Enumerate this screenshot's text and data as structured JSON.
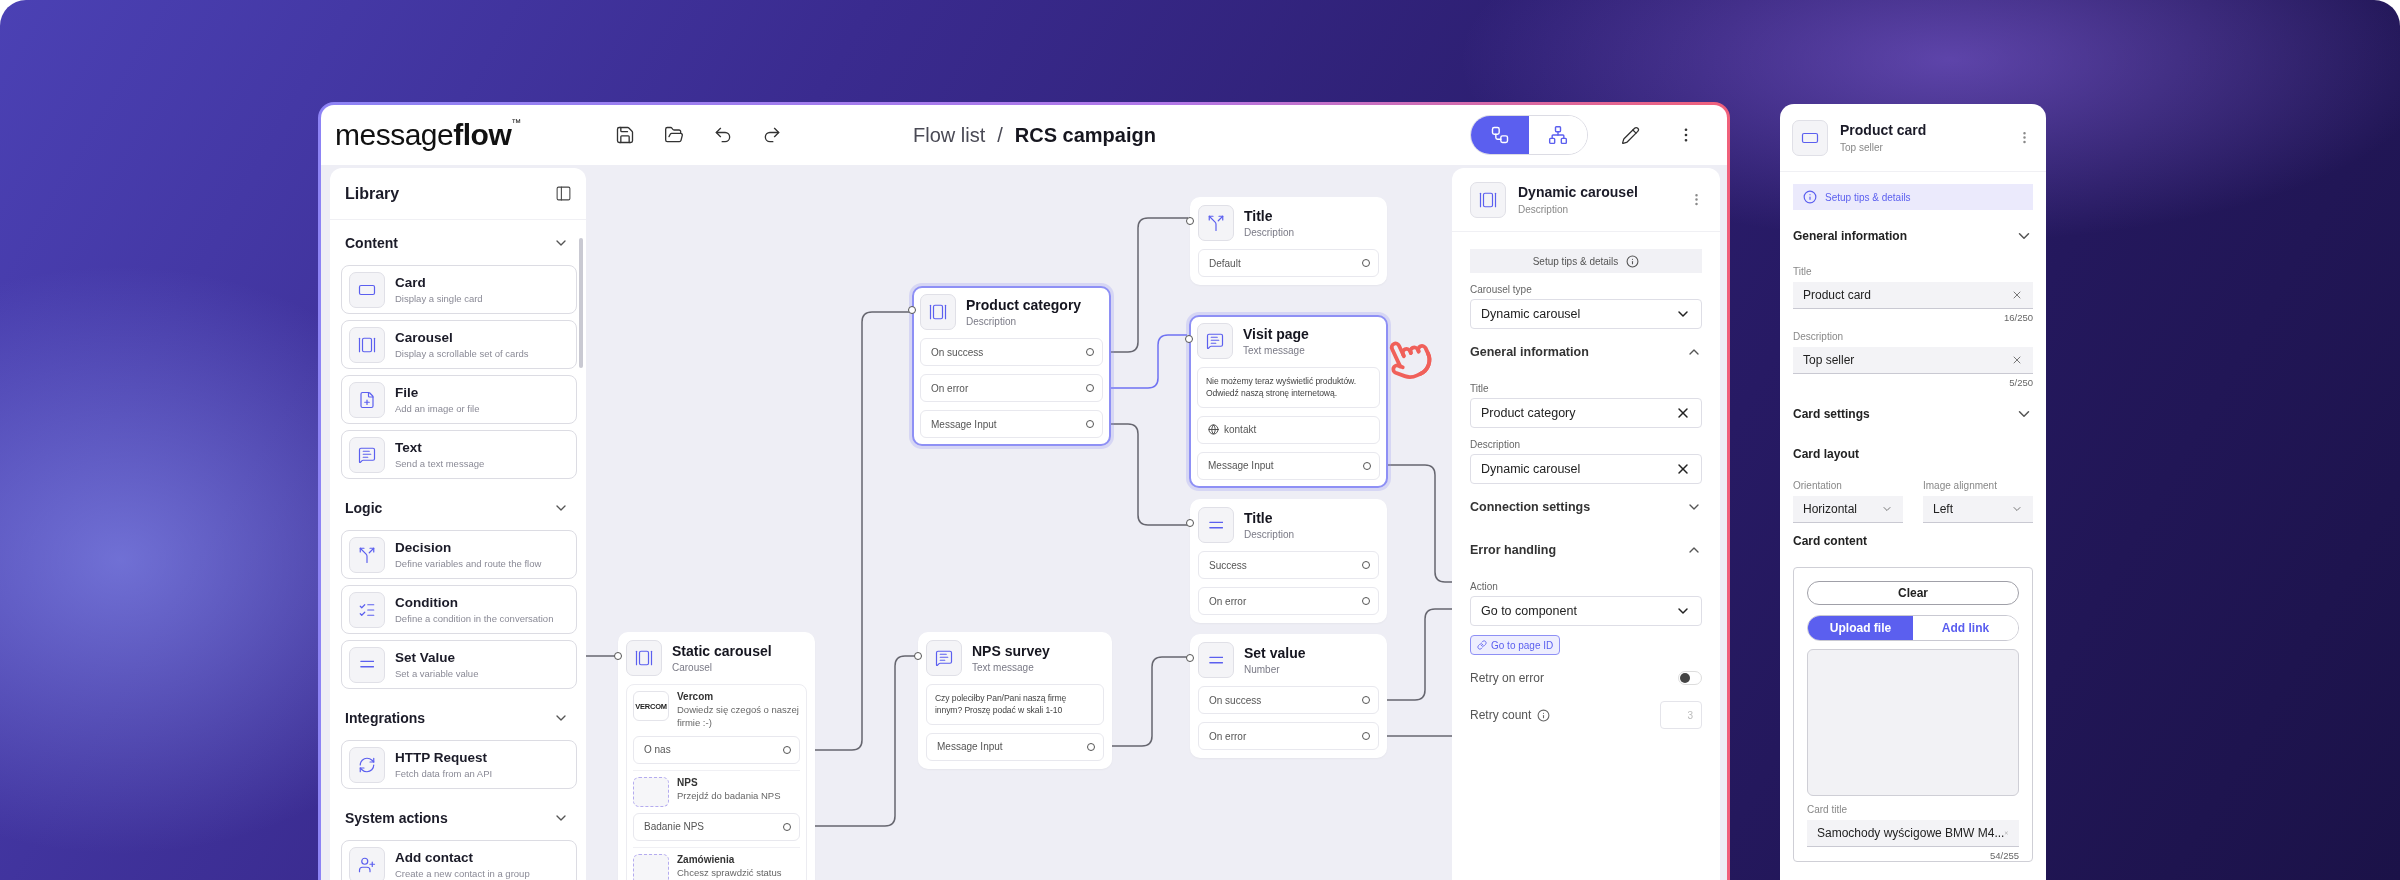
{
  "header": {
    "logo": "message**flow**$^{™}$",
    "breadcrumb": [
      "Flow list",
      "RCS campaign"
    ],
    "separator": "/",
    "view_toggle": [
      {
        "kind": "flow",
        "selected": true
      },
      {
        "kind": "tree",
        "selected": false
      }
    ]
  },
  "library": {
    "title": "Library",
    "sections": [
      {
        "title": "Content",
        "items": [
          {
            "kind": "card",
            "title": "Card",
            "description": "Display a single card"
          },
          {
            "kind": "carousel",
            "title": "Carousel",
            "description": "Display a scrollable set of cards"
          },
          {
            "kind": "file",
            "title": "File",
            "description": "Add an image or file"
          },
          {
            "kind": "text",
            "title": "Text",
            "description": "Send a text message"
          }
        ]
      },
      {
        "title": "Logic",
        "items": [
          {
            "kind": "decision",
            "title": "Decision",
            "description": "Define variables and route the flow"
          },
          {
            "kind": "condition",
            "title": "Condition",
            "description": "Define a condition in the conversation"
          },
          {
            "kind": "set_value",
            "title": "Set Value",
            "description": "Set a variable value"
          }
        ]
      },
      {
        "title": "Integrations",
        "items": [
          {
            "kind": "http",
            "title": "HTTP Request",
            "description": "Fetch data from an API"
          }
        ]
      },
      {
        "title": "System actions",
        "items": [
          {
            "kind": "contact",
            "title": "Add contact",
            "description": "Create a new contact in a group"
          }
        ]
      }
    ]
  },
  "canvas": {
    "nodes": [
      {
        "kind": "decision",
        "title": "Title",
        "subtitle": "Description",
        "selected": false,
        "rows": [
          {
            "kind": "output",
            "label": "Default"
          }
        ]
      },
      {
        "kind": "carousel",
        "title": "Product category",
        "subtitle": "Description",
        "selected": true,
        "rows": [
          {
            "kind": "output",
            "label": "On success"
          },
          {
            "kind": "output",
            "label": "On error"
          },
          {
            "kind": "output",
            "label": "Message Input"
          }
        ]
      },
      {
        "kind": "text",
        "title": "Visit page",
        "subtitle": "Text message",
        "selected": true,
        "rows": [
          {
            "kind": "message",
            "text": "Nie możemy teraz wyświetlić produktów. Odwiedź naszą stronę internetową."
          },
          {
            "kind": "link",
            "label": "kontakt"
          },
          {
            "kind": "output",
            "label": "Message Input"
          }
        ]
      },
      {
        "kind": "set_value",
        "title": "Title",
        "subtitle": "Description",
        "selected": false,
        "rows": [
          {
            "kind": "output",
            "label": "Success"
          },
          {
            "kind": "output",
            "label": "On error"
          }
        ]
      },
      {
        "kind": "carousel",
        "title": "Static carousel",
        "subtitle": "Carousel",
        "selected": false,
        "cards": [
          {
            "kind": "logo",
            "logo": "VERCOM",
            "title": "Vercom",
            "text": "Dowiedz się czegoś o naszej firmie :-)",
            "button": "O nas"
          },
          {
            "kind": "placeholder",
            "title": "NPS",
            "text": "Przejdź do badania NPS",
            "button": "Badanie NPS"
          },
          {
            "kind": "placeholder",
            "title": "Zamówienia",
            "text": "Chcesz sprawdzić status"
          }
        ]
      },
      {
        "kind": "text",
        "title": "NPS survey",
        "subtitle": "Text message",
        "selected": false,
        "rows": [
          {
            "kind": "message",
            "text": "Czy poleciłby Pan/Pani naszą firmę innym? Proszę podać w skali 1-10"
          },
          {
            "kind": "output",
            "label": "Message Input"
          }
        ]
      },
      {
        "kind": "set_value",
        "title": "Set value",
        "subtitle": "Number",
        "selected": false,
        "rows": [
          {
            "kind": "output",
            "label": "On success"
          },
          {
            "kind": "output",
            "label": "On error"
          }
        ]
      }
    ]
  },
  "properties": {
    "kind": "carousel",
    "title": "Dynamic carousel",
    "subtitle": "Description",
    "tips": "Setup tips & details",
    "items": [
      {
        "kind": "select",
        "label": "Carousel type",
        "value": "Dynamic carousel"
      },
      {
        "kind": "section",
        "title": "General information",
        "expanded": true
      },
      {
        "kind": "text",
        "label": "Title",
        "value": "Product category"
      },
      {
        "kind": "text",
        "label": "Description",
        "value": "Dynamic carousel"
      },
      {
        "kind": "section",
        "title": "Connection settings",
        "expanded": false
      },
      {
        "kind": "section",
        "title": "Error handling",
        "expanded": true
      },
      {
        "kind": "select",
        "label": "Action",
        "value": "Go to component"
      },
      {
        "kind": "chip",
        "label": "Go to page ID"
      },
      {
        "kind": "toggle",
        "label": "Retry on error",
        "on": false
      },
      {
        "kind": "number",
        "label": "Retry count",
        "placeholder": "3"
      }
    ]
  },
  "card_panel": {
    "title": "Product card",
    "subtitle": "Top seller",
    "tips": "Setup tips & details",
    "items": [
      {
        "kind": "section",
        "title": "General information"
      },
      {
        "kind": "text",
        "label": "Title",
        "value": "Product card",
        "counter": "16/250"
      },
      {
        "kind": "text",
        "label": "Description",
        "value": "Top seller",
        "counter": "5/250"
      },
      {
        "kind": "section",
        "title": "Card settings"
      },
      {
        "kind": "heading",
        "title": "Card layout"
      },
      {
        "kind": "select_pair",
        "fields": [
          {
            "label": "Orientation",
            "value": "Horizontal"
          },
          {
            "label": "Image alignment",
            "value": "Left"
          }
        ]
      },
      {
        "kind": "heading",
        "title": "Card content"
      },
      {
        "kind": "content_box",
        "clear": "Clear",
        "options": [
          {
            "label": "Upload file",
            "selected": true
          },
          {
            "label": "Add link",
            "selected": false
          }
        ],
        "field": {
          "label": "Card title",
          "value": "Samochody wyścigowe BMW M4...",
          "counter": "54/255"
        }
      }
    ]
  }
}
